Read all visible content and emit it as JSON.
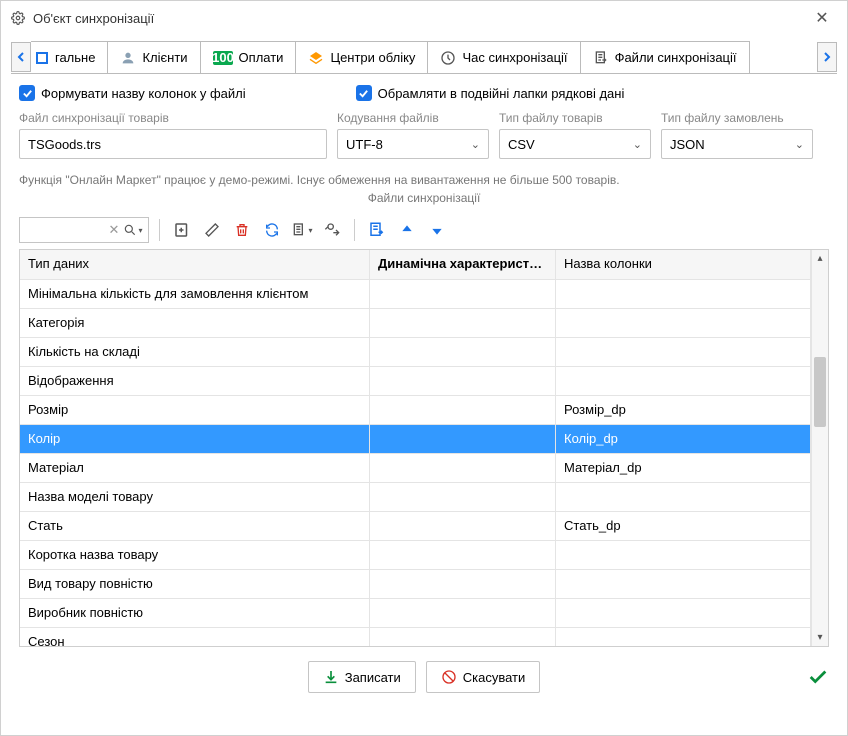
{
  "window": {
    "title": "Об'єкт синхронізації"
  },
  "tabs": {
    "items": [
      {
        "label": "гальне",
        "icon": "#1a73e8"
      },
      {
        "label": "Клієнти",
        "icon": "#8aa0b3"
      },
      {
        "label": "Оплати",
        "icon": "#0aa84f"
      },
      {
        "label": "Центри обліку",
        "icon": "#ff9800"
      },
      {
        "label": "Час синхронізації",
        "icon": "#555"
      },
      {
        "label": "Файли синхронізації",
        "icon": "#555",
        "active": true
      }
    ]
  },
  "checks": {
    "format_col": "Формувати назву колонок у файлі",
    "quote_str": "Обрамляти в подвійні лапки рядкові дані"
  },
  "fields": {
    "file_label": "Файл синхронізації товарів",
    "file_value": "TSGoods.trs",
    "encoding_label": "Кодування файлів",
    "encoding_value": "UTF-8",
    "type_goods_label": "Тип файлу товарів",
    "type_goods_value": "CSV",
    "type_orders_label": "Тип файлу замовлень",
    "type_orders_value": "JSON"
  },
  "demo_note": "Функція \"Онлайн Маркет\" працює у демо-режимі. Існує обмеження на вивантаження не більше 500 товарів.",
  "section_title": "Файли синхронізації",
  "grid": {
    "columns": [
      "Тип даних",
      "Динамічна характеристика",
      "Назва колонки"
    ],
    "rows": [
      {
        "c1": "Мінімальна кількість для замовлення клієнтом",
        "c2": "",
        "c3": ""
      },
      {
        "c1": "Категорія",
        "c2": "",
        "c3": ""
      },
      {
        "c1": "Кількість на складі",
        "c2": "",
        "c3": ""
      },
      {
        "c1": "Відображення",
        "c2": "",
        "c3": ""
      },
      {
        "c1": "Розмір",
        "c2": "",
        "c3": "Розмір_dp"
      },
      {
        "c1": "Колір",
        "c2": "",
        "c3": "Колір_dp",
        "selected": true
      },
      {
        "c1": "Матеріал",
        "c2": "",
        "c3": "Матеріал_dp"
      },
      {
        "c1": "Назва моделі товару",
        "c2": "",
        "c3": ""
      },
      {
        "c1": "Стать",
        "c2": "",
        "c3": "Стать_dp"
      },
      {
        "c1": "Коротка назва товару",
        "c2": "",
        "c3": ""
      },
      {
        "c1": "Вид товару повністю",
        "c2": "",
        "c3": ""
      },
      {
        "c1": "Виробник повністю",
        "c2": "",
        "c3": ""
      },
      {
        "c1": "Сезон",
        "c2": "",
        "c3": ""
      }
    ]
  },
  "buttons": {
    "save": "Записати",
    "cancel": "Скасувати"
  }
}
